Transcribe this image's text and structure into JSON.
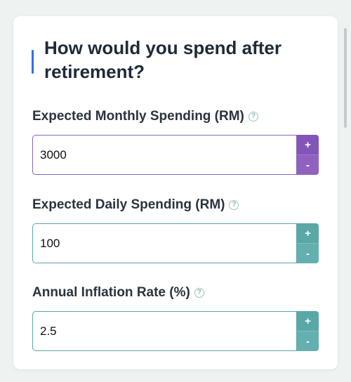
{
  "header": {
    "title": "How would you spend after retirement?"
  },
  "fields": [
    {
      "label": "Expected Monthly Spending (RM)",
      "value": "3000",
      "help_icon": "question-circle-icon",
      "plus": "+",
      "minus": "-"
    },
    {
      "label": "Expected Daily Spending (RM)",
      "value": "100",
      "help_icon": "question-circle-icon",
      "plus": "+",
      "minus": "-"
    },
    {
      "label": "Annual Inflation Rate (%)",
      "value": "2.5",
      "help_icon": "question-circle-icon",
      "plus": "+",
      "minus": "-"
    }
  ],
  "help_glyph": "?",
  "colors": {
    "accent": "#2f6fea",
    "teal": "#5aa7a8",
    "purple": "#8455b8"
  }
}
